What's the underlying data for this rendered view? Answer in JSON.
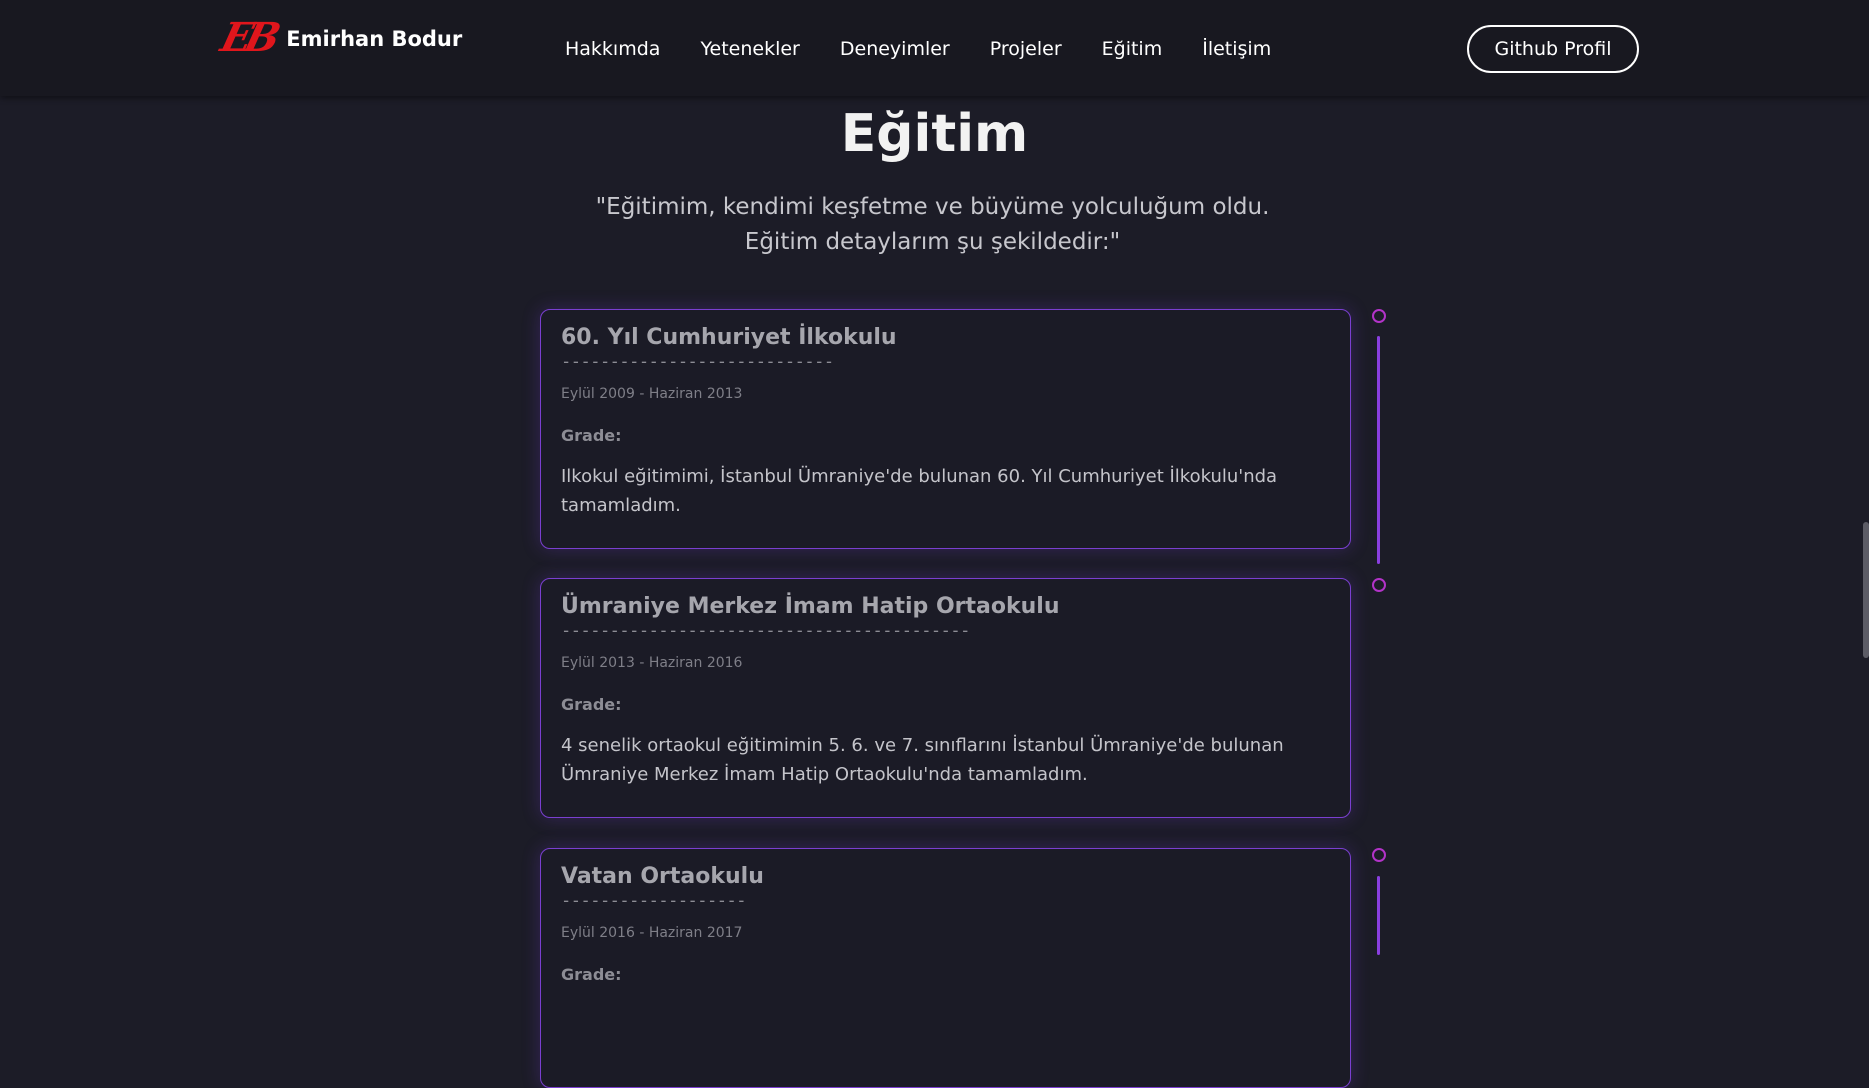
{
  "header": {
    "logo_mark": "EB",
    "logo_name": "Emirhan Bodur",
    "nav": [
      "Hakkımda",
      "Yetenekler",
      "Deneyimler",
      "Projeler",
      "Eğitim",
      "İletişim"
    ],
    "github_button": "Github Profil"
  },
  "section": {
    "title": "Eğitim",
    "subtitle": "\"Eğitimim, kendimi keşfetme ve büyüme yolculuğum oldu. Eğitim detaylarım şu şekildedir:\""
  },
  "education": [
    {
      "school": "60. Yıl Cumhuriyet İlkokulu",
      "dashes": "----------------------------",
      "date": "Eylül 2009 - Haziran 2013",
      "grade": "Grade:",
      "description": "Ilkokul eğitimimi, İstanbul Ümraniye'de bulunan 60. Yıl Cumhuriyet İlkokulu'nda tamamladım."
    },
    {
      "school": "Ümraniye Merkez İmam Hatip Ortaokulu",
      "dashes": "------------------------------------------",
      "date": "Eylül 2013 - Haziran 2016",
      "grade": "Grade:",
      "description": "4 senelik ortaokul eğitimimin 5. 6. ve 7. sınıflarını İstanbul Ümraniye'de bulunan Ümraniye Merkez İmam Hatip Ortaokulu'nda tamamladım."
    },
    {
      "school": "Vatan Ortaokulu",
      "dashes": "-------------------",
      "date": "Eylül 2016 - Haziran 2017",
      "grade": "Grade:",
      "description": ""
    }
  ],
  "colors": {
    "background": "#1c1c27",
    "navbar": "#181820",
    "accent_border": "#7a3fd0",
    "timeline_line": "#8a3fe0",
    "timeline_dot": "#b233c8",
    "logo_red": "#e0161c"
  }
}
